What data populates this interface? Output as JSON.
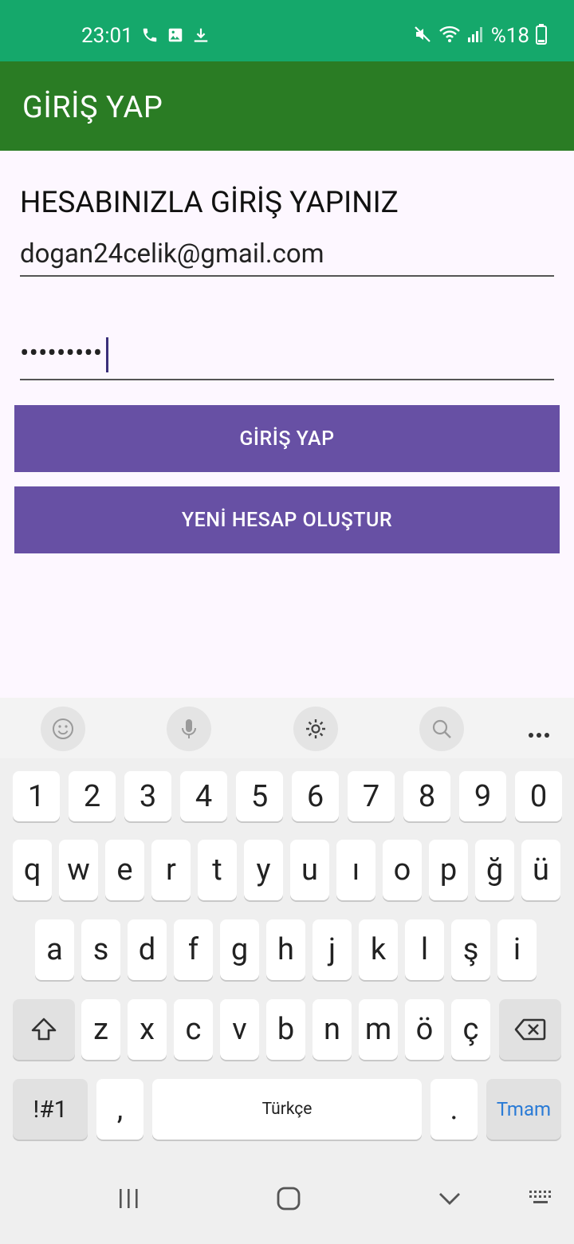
{
  "status_bar": {
    "time": "23:01",
    "battery": "%18",
    "icons": [
      "call-icon",
      "image-icon",
      "download-icon",
      "mute-icon",
      "wifi-icon",
      "signal-icon",
      "battery-icon"
    ]
  },
  "app_bar": {
    "title": "GİRİŞ YAP"
  },
  "form": {
    "heading": "HESABINIZLA GİRİŞ YAPINIZ",
    "email_value": "dogan24celik@gmail.com",
    "password_masked": "•••••••••",
    "login_button": "GİRİŞ YAP",
    "register_button": "YENİ HESAP OLUŞTUR"
  },
  "keyboard": {
    "toolbar": [
      "emoji-icon",
      "mic-icon",
      "settings-icon",
      "search-icon",
      "more-icon"
    ],
    "row_numbers": [
      "1",
      "2",
      "3",
      "4",
      "5",
      "6",
      "7",
      "8",
      "9",
      "0"
    ],
    "row1": [
      "q",
      "w",
      "e",
      "r",
      "t",
      "y",
      "u",
      "ı",
      "o",
      "p",
      "ğ",
      "ü"
    ],
    "row2": [
      "a",
      "s",
      "d",
      "f",
      "g",
      "h",
      "j",
      "k",
      "l",
      "ş",
      "i"
    ],
    "row3": [
      "z",
      "x",
      "c",
      "v",
      "b",
      "n",
      "m",
      "ö",
      "ç"
    ],
    "sym_key": "!#1",
    "comma_key": ",",
    "space_label": "Türkçe",
    "period_key": ".",
    "done_key": "Tmam"
  },
  "colors": {
    "status_bar": "#15a86b",
    "app_bar": "#2a7c24",
    "button": "#6750a4"
  }
}
